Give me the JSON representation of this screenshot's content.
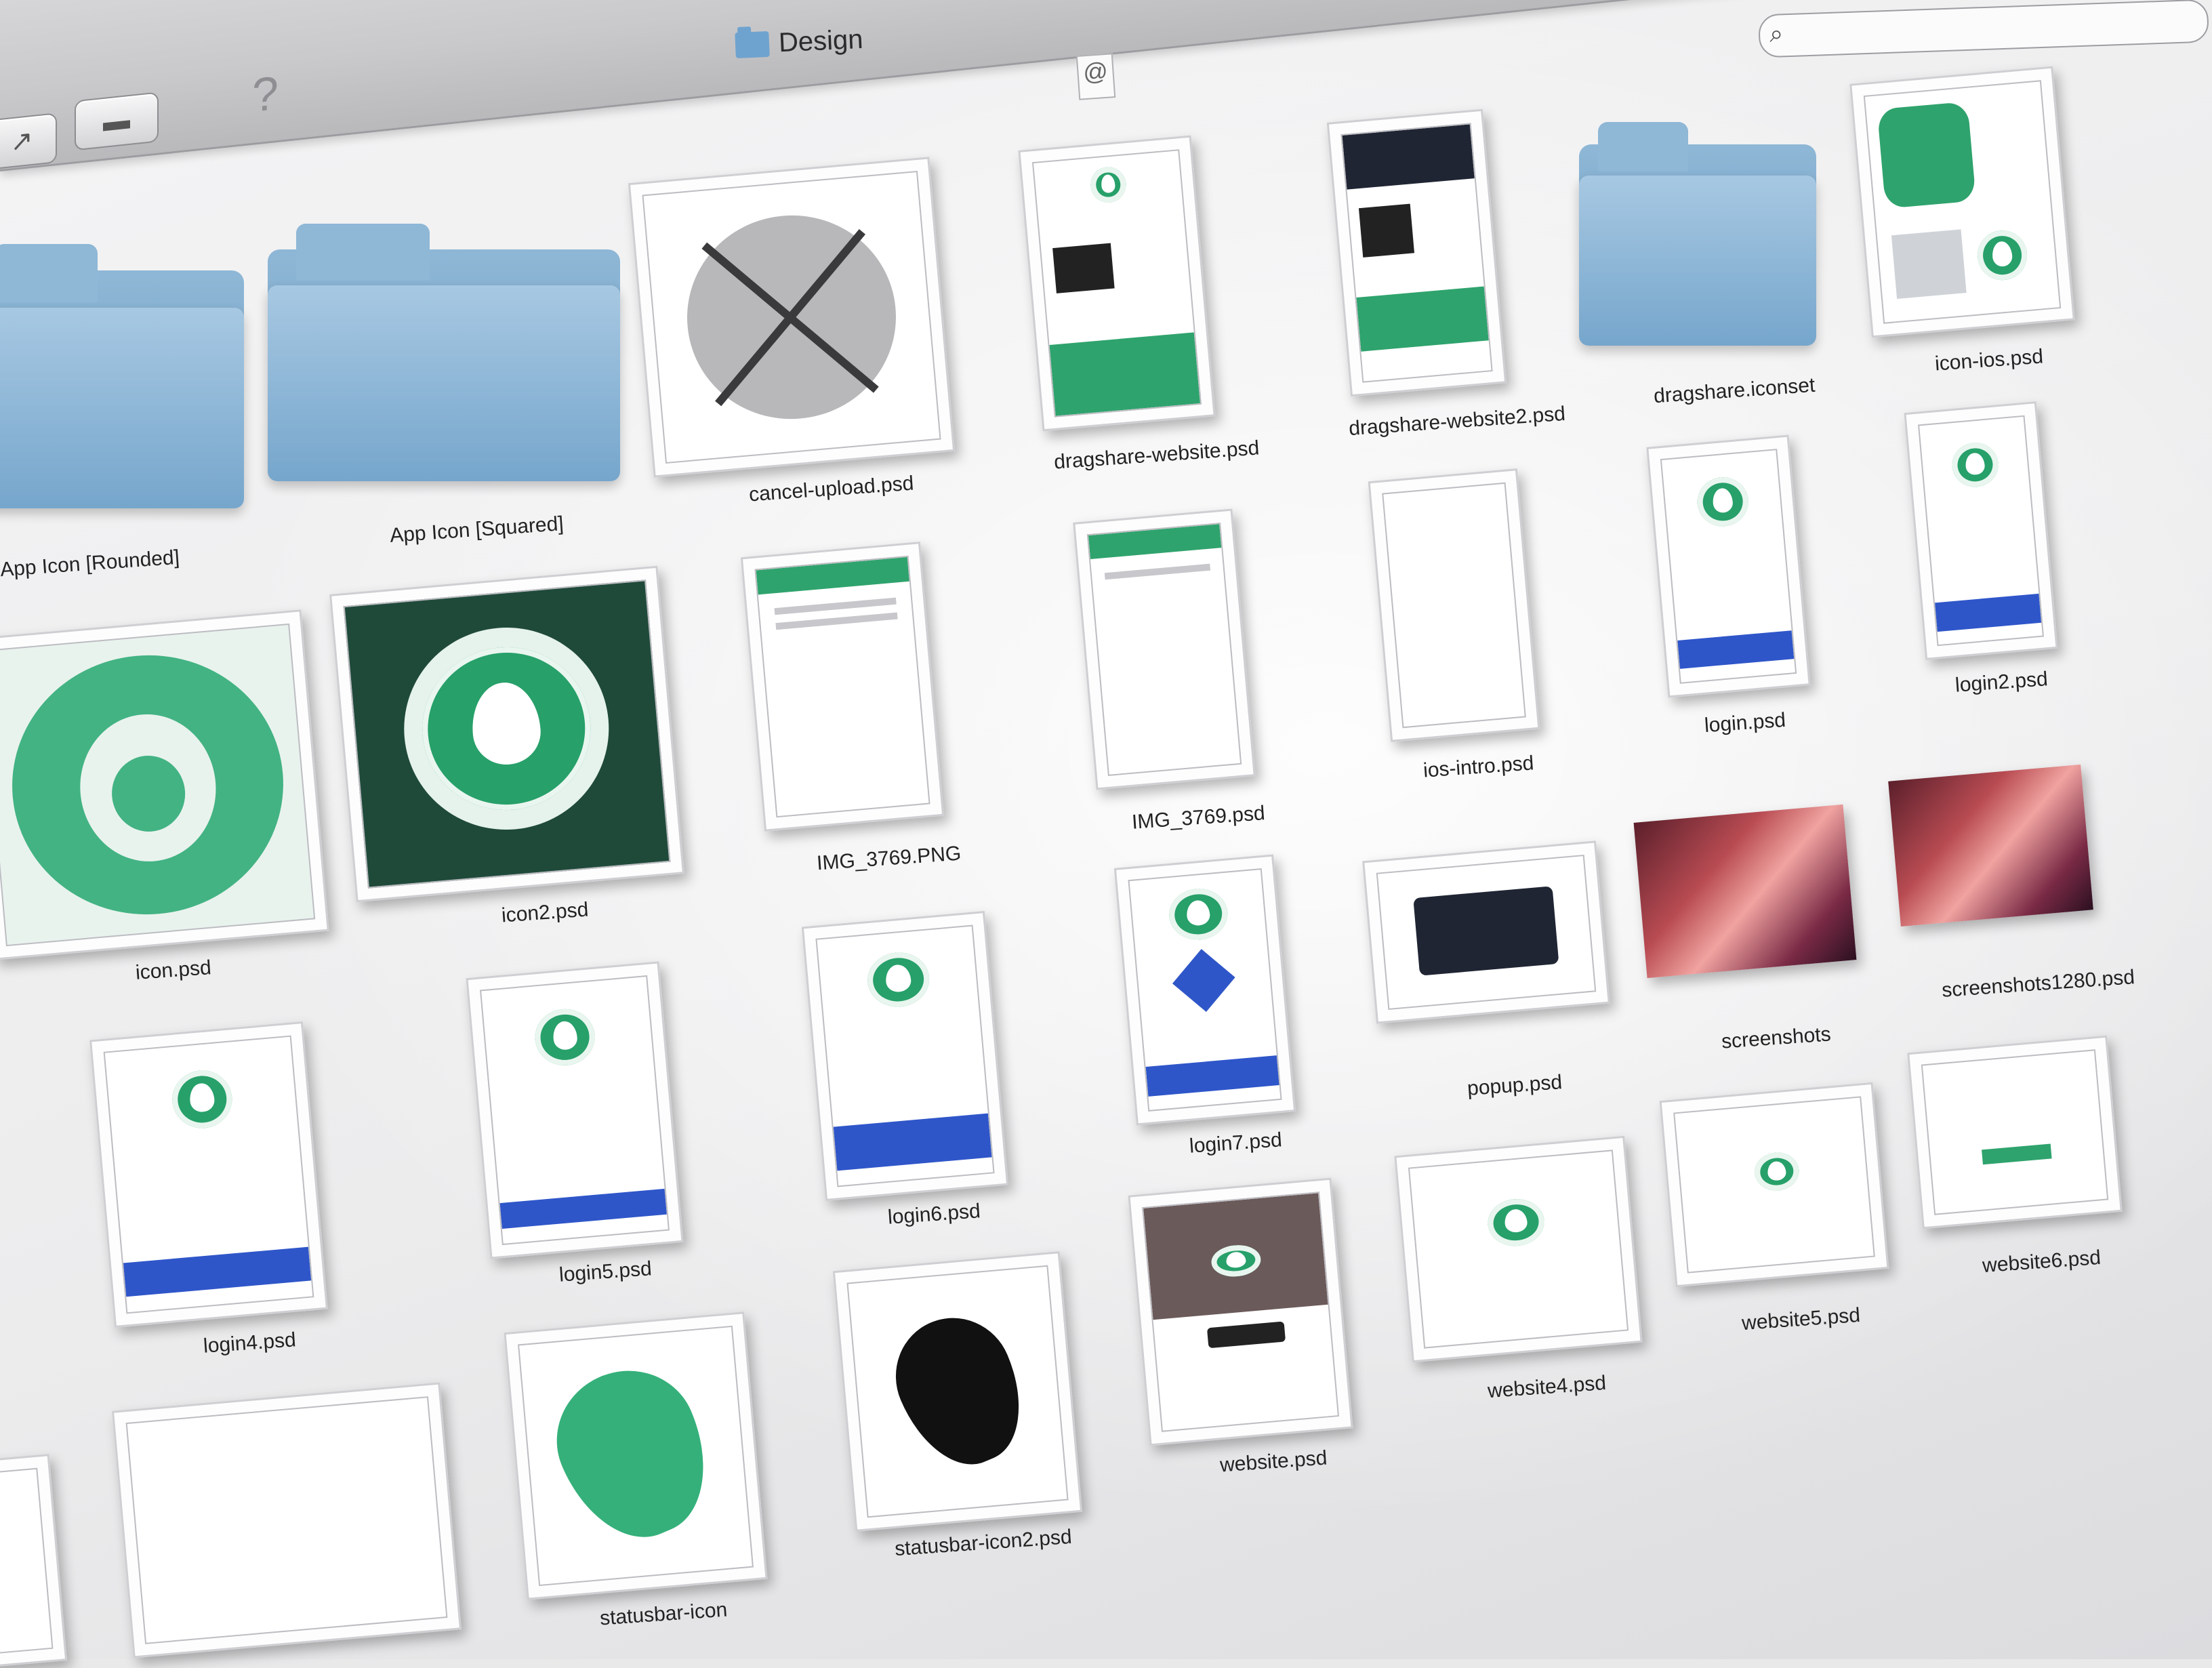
{
  "window": {
    "title": "Design",
    "proxy_icon": "vcard-at-icon",
    "help_glyph": "?"
  },
  "toolbar": {
    "share_icon": "share-icon",
    "label_icon": "label-toggle-icon",
    "search_placeholder": ""
  },
  "files": [
    {
      "name": "App Icon [Rounded]",
      "kind": "folder"
    },
    {
      "name": "App Icon [Squared]",
      "kind": "folder"
    },
    {
      "name": "cancel-upload.psd",
      "kind": "psd"
    },
    {
      "name": "dragshare-website.psd",
      "kind": "psd"
    },
    {
      "name": "dragshare-website2.psd",
      "kind": "psd"
    },
    {
      "name": "dragshare.iconset",
      "kind": "folder"
    },
    {
      "name": "icon-ios.psd",
      "kind": "psd"
    },
    {
      "name": "icon.psd",
      "kind": "psd"
    },
    {
      "name": "icon2.psd",
      "kind": "psd"
    },
    {
      "name": "IMG_3769.PNG",
      "kind": "png"
    },
    {
      "name": "IMG_3769.psd",
      "kind": "psd"
    },
    {
      "name": "ios-intro.psd",
      "kind": "psd"
    },
    {
      "name": "login.psd",
      "kind": "psd"
    },
    {
      "name": "login2.psd",
      "kind": "psd"
    },
    {
      "name": "login4.psd",
      "kind": "psd"
    },
    {
      "name": "login5.psd",
      "kind": "psd"
    },
    {
      "name": "login6.psd",
      "kind": "psd"
    },
    {
      "name": "login7.psd",
      "kind": "psd"
    },
    {
      "name": "popup.psd",
      "kind": "psd"
    },
    {
      "name": "screenshots",
      "kind": "folder"
    },
    {
      "name": "screenshots1280.psd",
      "kind": "psd"
    },
    {
      "name": "website.psd",
      "kind": "psd"
    },
    {
      "name": "website4.psd",
      "kind": "psd"
    },
    {
      "name": "website5.psd",
      "kind": "psd"
    },
    {
      "name": "website6.psd",
      "kind": "psd"
    },
    {
      "name": "statusbar-icon",
      "kind": "psd"
    },
    {
      "name": "statusbar-icon2.psd",
      "kind": "psd"
    }
  ],
  "colors": {
    "accent_green": "#2fa36d",
    "connect_blue": "#2f56c9",
    "folder_blue": "#76a6cc"
  }
}
